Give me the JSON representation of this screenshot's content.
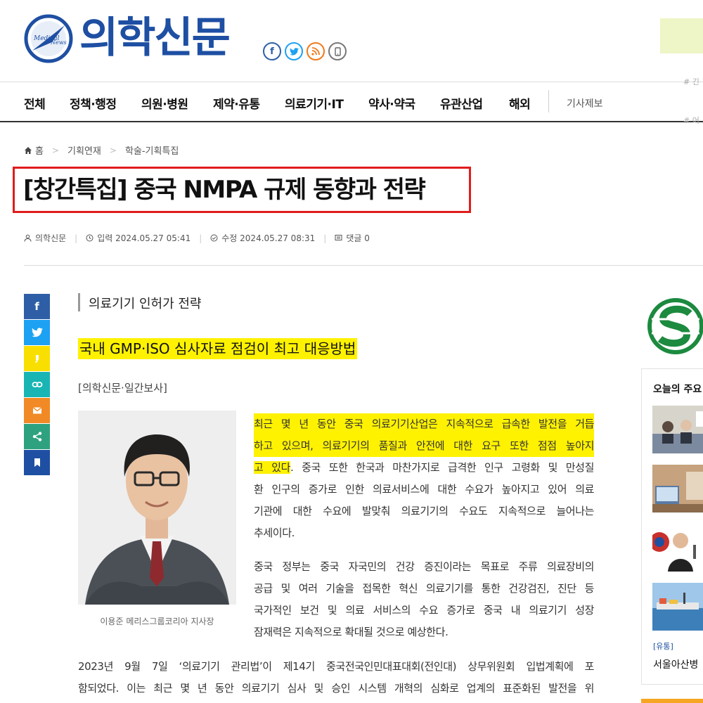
{
  "site": {
    "logo_text": "의학신문",
    "emblem_text_1": "Medical",
    "emblem_text_2": "News"
  },
  "sns": [
    {
      "name": "facebook",
      "glyph": "f"
    },
    {
      "name": "twitter",
      "glyph": "t"
    },
    {
      "name": "rss",
      "glyph": "r"
    },
    {
      "name": "mobile",
      "glyph": "m"
    }
  ],
  "nav": {
    "items": [
      "전체",
      "정책·행정",
      "의원·병원",
      "제약·유통",
      "의료기기·IT",
      "약사·약국",
      "유관산업",
      "해외"
    ],
    "submit_label": "기사제보",
    "edge_tags": [
      "# 긴",
      "# 어"
    ]
  },
  "breadcrumb": [
    "홈",
    "기획연재",
    "학술-기획특집"
  ],
  "article": {
    "headline": "[창간특집] 중국 NMPA 규제 동향과 전략",
    "meta": {
      "author": "의학신문",
      "published": "입력 2024.05.27 05:41",
      "modified": "수정 2024.05.27 08:31",
      "comments": "댓글 0"
    },
    "subtitle": "의료기기 인허가 전략",
    "highlight_heading": "국내 GMP·ISO 심사자료 점검이 최고 대응방법",
    "press": "[의학신문·일간보사]",
    "photo_caption": "이용준 메리스그룹코리아 지사장",
    "p1": {
      "highlighted": [
        "최근 몇 년 동안 중국 의료기기산업은 지속적으로 급속한 발전을 거듭",
        "하고 있으며, 의료기기의 품질과 안전에 대한 요구 또한 점점 높아지",
        "고 있다"
      ],
      "after_highlight": ". 중국 또한 한국과 마찬가지로 급격한 인구 고령화 및 만성질",
      "lines": [
        "환 인구의 증가로 인한 의료서비스에 대한 수요가 높아지고 있어 의료",
        "기관에 대한 수요에 발맞춰 의료기기의 수요도 지속적으로 늘어나는",
        "추세이다."
      ]
    },
    "p2": [
      "중국 정부는 중국 자국민의 건강 증진이라는 목표로 주류 의료장비의",
      "공급 및 여러 기술을 접목한 혁신 의료기기를 통한 건강검진, 진단 등",
      "국가적인 보건 및 의료 서비스의 수요 증가로 중국 내 의료기기 성장",
      "잠재력은 지속적으로 확대될 것으로 예상한다."
    ],
    "p3": [
      "2023년 9월 7일 ‘의료기기 관리법’이 제14기 중국전국인민대표대회(전인대) 상무위원회 입법계획에 포",
      "함되었다. 이는 최근 몇 년 동안 의료기기 심사 및 승인 시스템 개혁의 심화로 업계의 표준화된 발전을 위"
    ]
  },
  "sidebar": {
    "title": "오늘의 주요",
    "tag": "[유통]",
    "news_title": "서울아산병"
  },
  "colors": {
    "brand_blue": "#1e4fa3",
    "headline_border": "#e01c1c",
    "highlight_yellow": "#fff200",
    "share_facebook": "#2e5fa6",
    "share_twitter": "#1da1f2",
    "share_kakao": "#f9df00",
    "share_link": "#19b5b5",
    "share_mail": "#f18a26",
    "share_more": "#2ea27e",
    "share_bookmark": "#1e4fa3"
  }
}
